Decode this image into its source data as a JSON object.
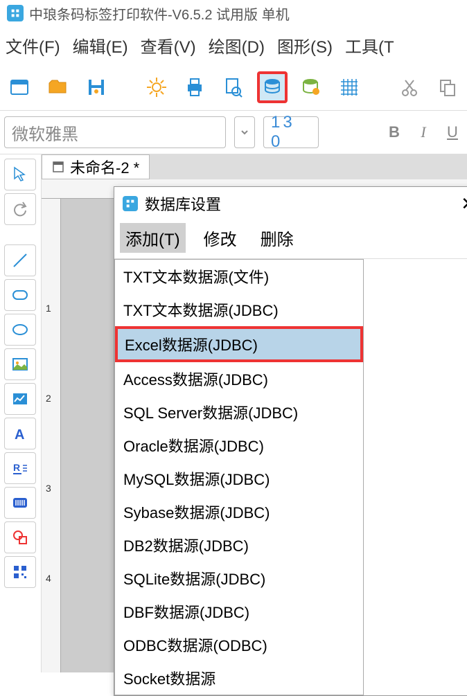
{
  "title": "中琅条码标签打印软件-V6.5.2 试用版 单机",
  "menu": {
    "file": "文件(F)",
    "edit": "编辑(E)",
    "view": "查看(V)",
    "draw": "绘图(D)",
    "shape": "图形(S)",
    "tool": "工具(T"
  },
  "font": {
    "name": "微软雅黑",
    "size": "13 0",
    "bold": "B",
    "italic": "I",
    "underline": "U"
  },
  "tab": {
    "name": "未命名-2 *"
  },
  "ruler_v": {
    "l1": "1",
    "l2": "2",
    "l3": "3",
    "l4": "4"
  },
  "dialog": {
    "title": "数据库设置",
    "add": "添加(T)",
    "modify": "修改",
    "delete": "删除"
  },
  "datasources": {
    "i0": "TXT文本数据源(文件)",
    "i1": "TXT文本数据源(JDBC)",
    "i2": "Excel数据源(JDBC)",
    "i3": "Access数据源(JDBC)",
    "i4": "SQL Server数据源(JDBC)",
    "i5": "Oracle数据源(JDBC)",
    "i6": "MySQL数据源(JDBC)",
    "i7": "Sybase数据源(JDBC)",
    "i8": "DB2数据源(JDBC)",
    "i9": "SQLite数据源(JDBC)",
    "i10": "DBF数据源(JDBC)",
    "i11": "ODBC数据源(ODBC)",
    "i12": "Socket数据源"
  }
}
